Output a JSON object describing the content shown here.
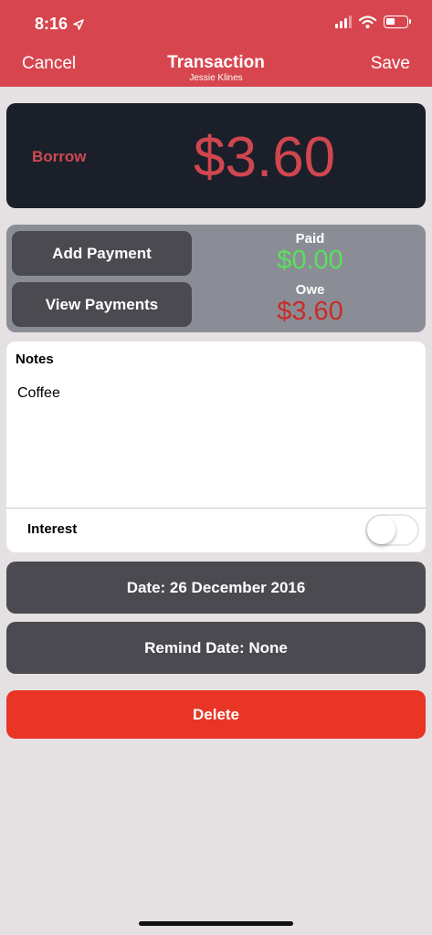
{
  "status_bar": {
    "time": "8:16",
    "location_icon": "location-arrow-icon",
    "signal_icon": "cellular-signal-icon",
    "wifi_icon": "wifi-icon",
    "battery_icon": "battery-icon",
    "battery_level": 0.3
  },
  "nav": {
    "cancel_label": "Cancel",
    "title": "Transaction",
    "subtitle": "Jessie Klines",
    "save_label": "Save"
  },
  "transaction": {
    "type": "Borrow",
    "amount": "$3.60"
  },
  "payments": {
    "add_label": "Add Payment",
    "view_label": "View Payments",
    "paid_label": "Paid",
    "paid_value": "$0.00",
    "owe_label": "Owe",
    "owe_value": "$3.60"
  },
  "notes": {
    "heading": "Notes",
    "text": "Coffee"
  },
  "interest": {
    "label": "Interest",
    "enabled": false
  },
  "date_button": {
    "label": "Date: 26 December 2016"
  },
  "remind_button": {
    "label": "Remind Date: None"
  },
  "delete_button": {
    "label": "Delete"
  },
  "colors": {
    "header": "#d7464f",
    "amount_card": "#1b1f2a",
    "amount_text": "#d0464f",
    "paid_green": "#5ae05e",
    "owe_red": "#c92c26",
    "button_dark": "#4b4a50",
    "delete_red": "#e93525",
    "background": "#e5e1e2"
  }
}
